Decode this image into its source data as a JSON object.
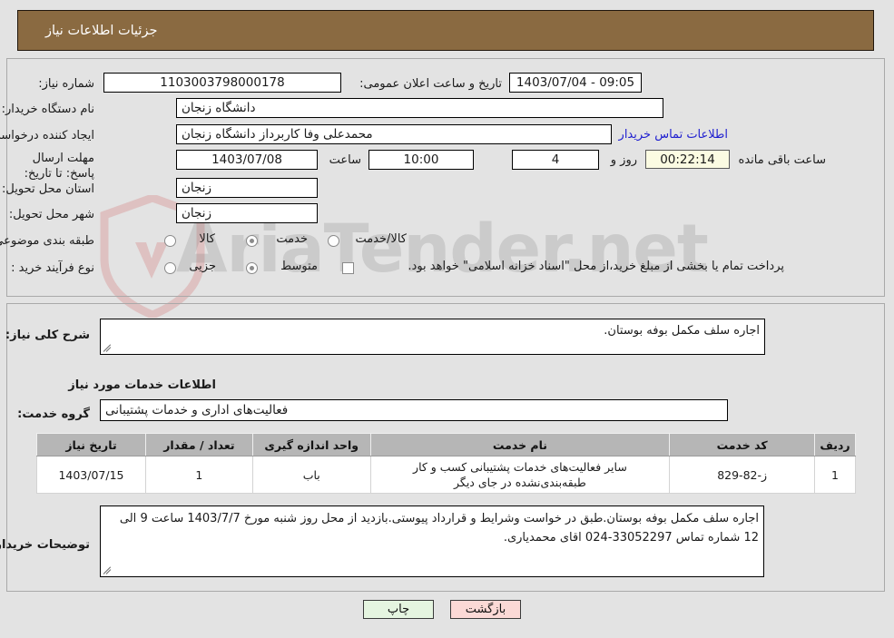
{
  "header": {
    "title": "جزئیات اطلاعات نیاز"
  },
  "watermark": {
    "text": "AriaTender.net"
  },
  "form": {
    "need_number_label": "شماره نیاز:",
    "need_number_value": "1103003798000178",
    "announce_label": "تاریخ و ساعت اعلان عمومی:",
    "announce_value": "09:05 - 1403/07/04",
    "buyer_org_label": "نام دستگاه خریدار:",
    "buyer_org_value": "دانشگاه زنجان",
    "requester_label": "ایجاد کننده درخواست:",
    "requester_value": "محمدعلی وفا کاربرداز دانشگاه زنجان",
    "contact_link": "اطلاعات تماس خریدار",
    "deadline_label": "مهلت ارسال پاسخ: تا تاریخ:",
    "deadline_date": "1403/07/08",
    "hour_word": "ساعت",
    "deadline_time": "10:00",
    "days_value": "4",
    "days_word": "روز و",
    "countdown_value": "00:22:14",
    "remaining_word": "ساعت باقی مانده",
    "province_label": "استان محل تحویل:",
    "province_value": "زنجان",
    "city_label": "شهر محل تحویل:",
    "city_value": "زنجان",
    "category_label": "طبقه بندی موضوعی:",
    "category_options": [
      "کالا",
      "خدمت",
      "کالا/خدمت"
    ],
    "category_selected": "خدمت",
    "process_label": "نوع فرآیند خرید :",
    "process_options": [
      "جزیی",
      "متوسط"
    ],
    "process_selected": "متوسط",
    "treasury_note": "پرداخت تمام یا بخشی از مبلغ خرید،از محل \"اسناد خزانه اسلامی\" خواهد بود."
  },
  "description": {
    "general_label": "شرح کلی نیاز:",
    "general_value": "اجاره سلف مکمل بوفه بوستان.",
    "section_title": "اطلاعات خدمات مورد نیاز",
    "service_group_label": "گروه خدمت:",
    "service_group_value": "فعالیت‌های اداری و خدمات پشتیبانی"
  },
  "service_table": {
    "columns": [
      "ردیف",
      "کد خدمت",
      "نام خدمت",
      "واحد اندازه گیری",
      "تعداد / مقدار",
      "تاریخ نیاز"
    ],
    "rows": [
      {
        "row": "1",
        "code": "ز-82-829",
        "name": "سایر فعالیت‌های خدمات پشتیبانی کسب و کار طبقه‌بندی‌نشده در جای دیگر",
        "unit": "باب",
        "quantity": "1",
        "date": "1403/07/15"
      }
    ]
  },
  "buyer_notes": {
    "label": "توضیحات خریدار:",
    "value": "اجاره سلف مکمل بوفه بوستان.طبق در خواست وشرایط و قرارداد پیوستی.بازدید از محل روز شنبه مورخ 1403/7/7 ساعت 9 الی 12 شماره تماس 33052297-024 اقای محمدیاری."
  },
  "buttons": {
    "print": "چاپ",
    "back": "بازگشت"
  }
}
